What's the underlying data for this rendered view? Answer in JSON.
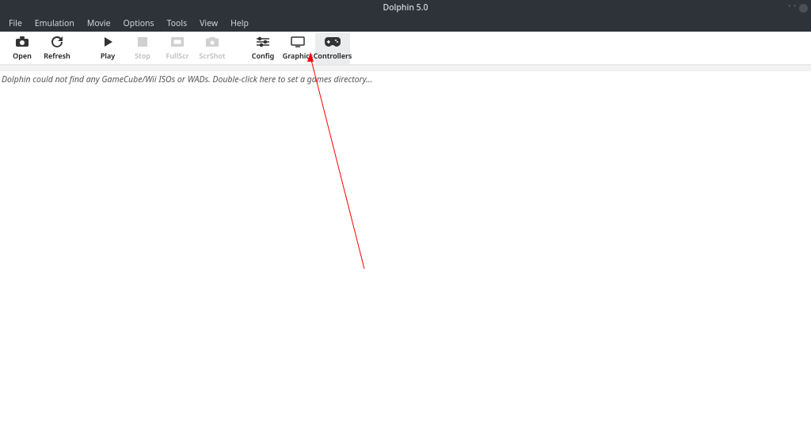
{
  "titlebar": {
    "title": "Dolphin 5.0"
  },
  "menubar": {
    "items": [
      "File",
      "Emulation",
      "Movie",
      "Options",
      "Tools",
      "View",
      "Help"
    ]
  },
  "toolbar": {
    "open": {
      "label": "Open"
    },
    "refresh": {
      "label": "Refresh"
    },
    "play": {
      "label": "Play"
    },
    "stop": {
      "label": "Stop"
    },
    "fullscr": {
      "label": "FullScr"
    },
    "scrshot": {
      "label": "ScrShot"
    },
    "config": {
      "label": "Config"
    },
    "graphics": {
      "label": "Graphics"
    },
    "controllers": {
      "label": "Controllers"
    }
  },
  "status": {
    "message": "Dolphin could not find any GameCube/Wii ISOs or WADs. Double-click here to set a games directory..."
  }
}
